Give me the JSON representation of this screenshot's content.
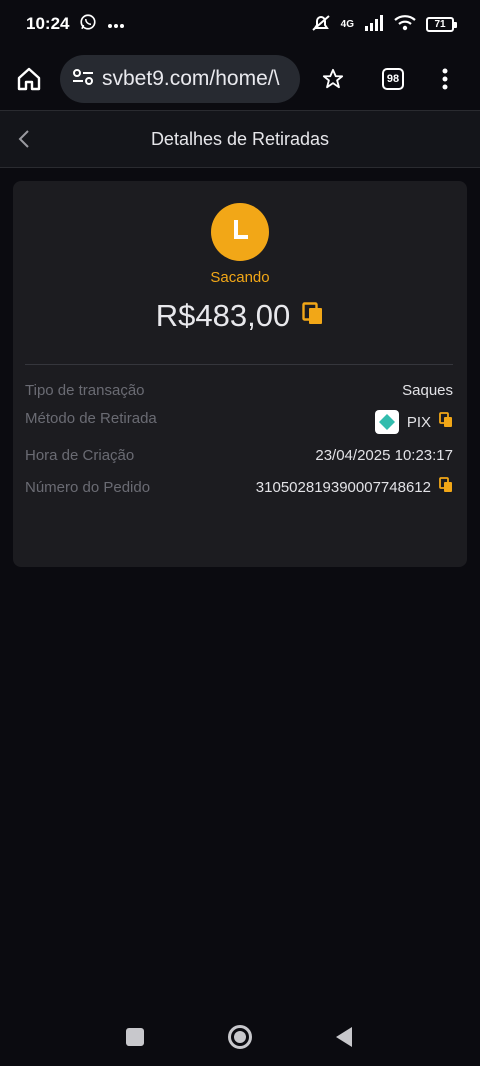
{
  "status_bar": {
    "time": "10:24",
    "signal": "4G",
    "battery": "71"
  },
  "browser": {
    "url": "svbet9.com/home/\\",
    "tab_count": "98"
  },
  "header": {
    "title": "Detalhes de Retiradas"
  },
  "withdrawal": {
    "status": "Sacando",
    "amount": "R$483,00",
    "status_color": "#f2a717",
    "details": {
      "transaction_type_label": "Tipo de transação",
      "transaction_type_value": "Saques",
      "method_label": "Método de Retirada",
      "method_value": "PIX",
      "created_label": "Hora de Criação",
      "created_value": "23/04/2025 10:23:17",
      "order_label": "Número do Pedido",
      "order_value": "310502819390007748612"
    }
  },
  "icons": {
    "copy": "copy-icon",
    "pix": "pix-icon",
    "clock": "clock-icon"
  }
}
